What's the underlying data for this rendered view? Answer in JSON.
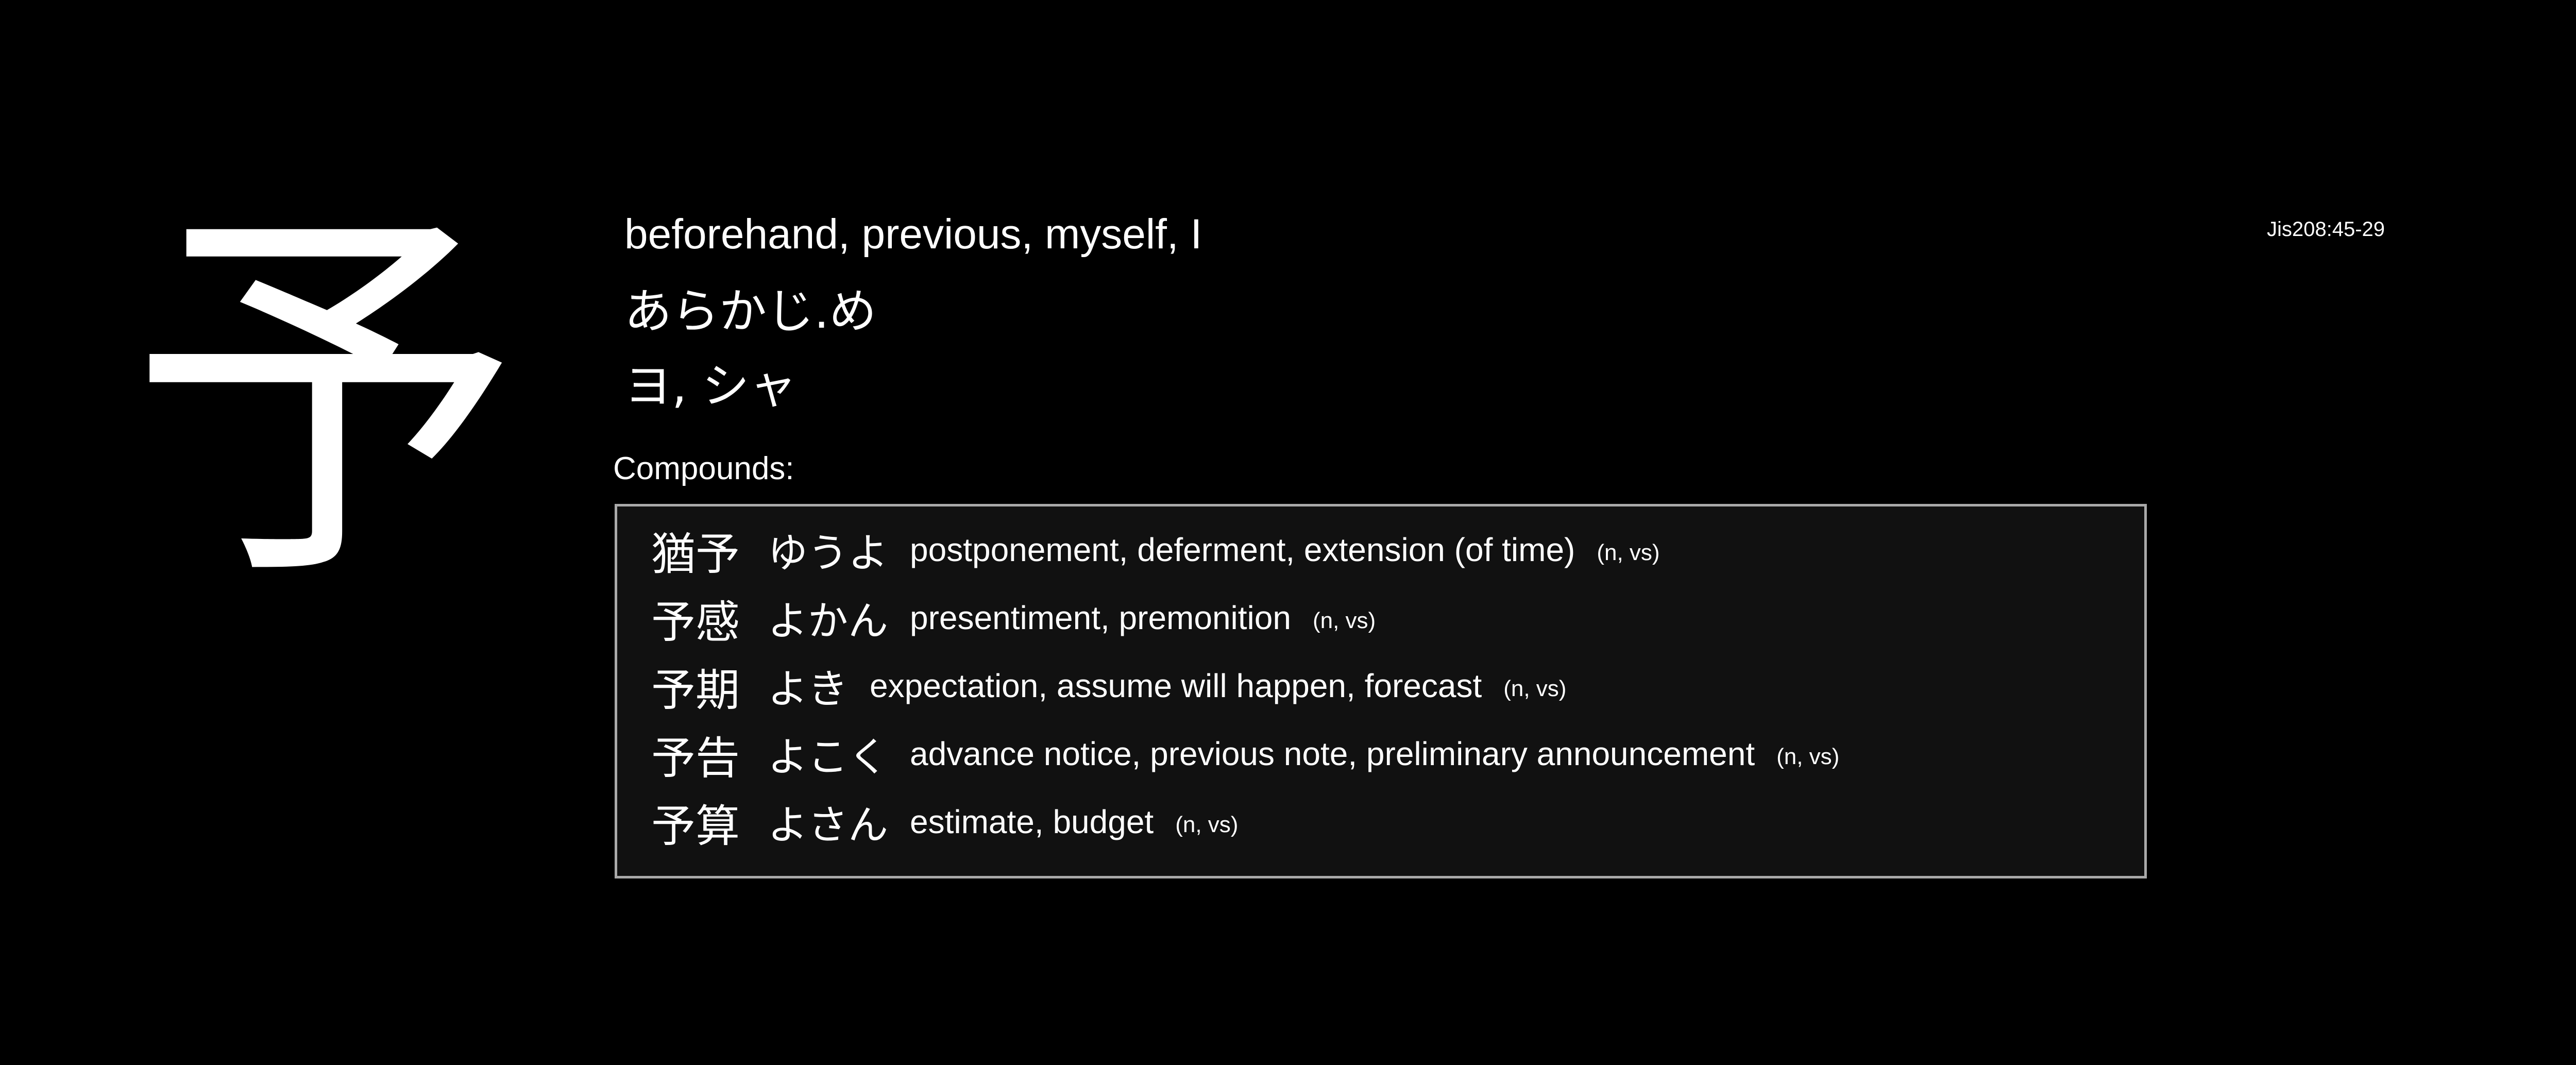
{
  "kanji": "予",
  "meanings": "beforehand, previous, myself, I",
  "kun_reading": "あらかじ.め",
  "on_reading": "ヨ, シャ",
  "code": "Jis208:45-29",
  "compounds_label": "Compounds:",
  "compounds": [
    {
      "word": "猶予",
      "reading": "ゆうよ",
      "gloss": "postponement, deferment, extension (of time)",
      "pos": "(n, vs)"
    },
    {
      "word": "予感",
      "reading": "よかん",
      "gloss": "presentiment, premonition",
      "pos": "(n, vs)"
    },
    {
      "word": "予期",
      "reading": "よき",
      "gloss": "expectation, assume will happen, forecast",
      "pos": "(n, vs)"
    },
    {
      "word": "予告",
      "reading": "よこく",
      "gloss": "advance notice, previous note, preliminary announcement",
      "pos": "(n, vs)"
    },
    {
      "word": "予算",
      "reading": "よさん",
      "gloss": "estimate, budget",
      "pos": "(n, vs)"
    }
  ],
  "colors": {
    "background": "#000000",
    "text": "#ffffff",
    "box_border": "#a9a9a9",
    "box_background": "#111111"
  }
}
